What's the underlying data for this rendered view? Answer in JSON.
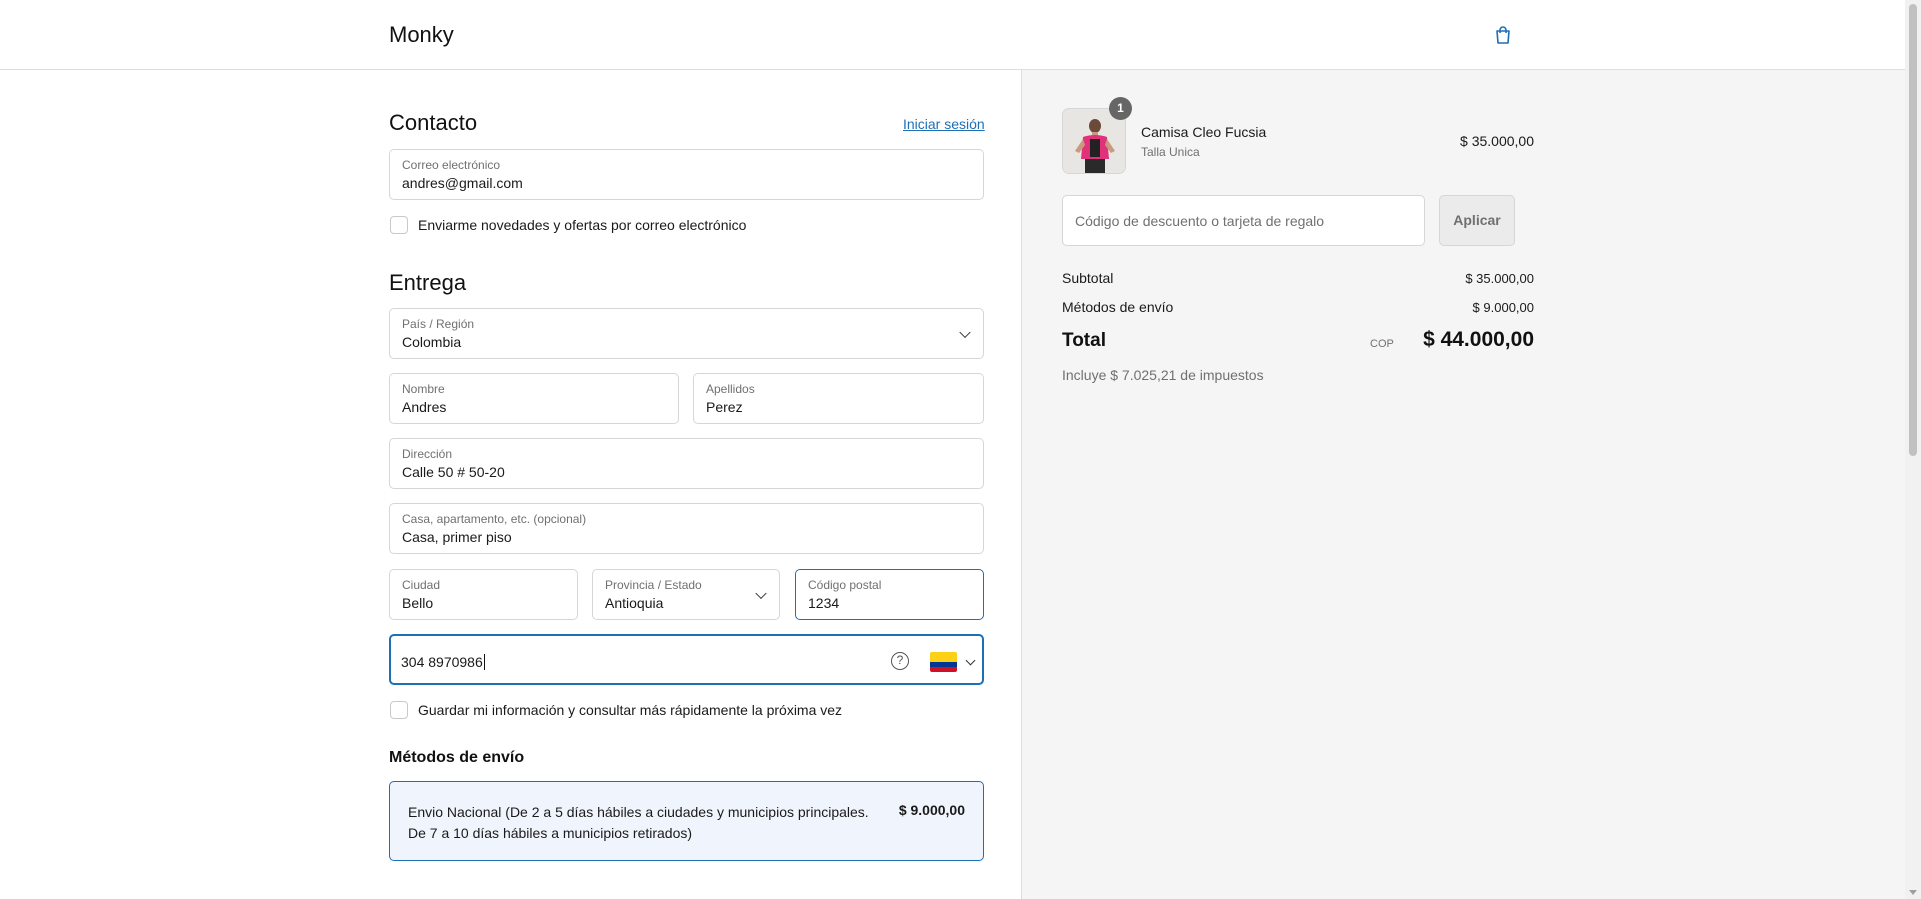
{
  "header": {
    "brand": "Monky",
    "cart_icon": "shopping-bag-icon"
  },
  "contact": {
    "title": "Contacto",
    "login_link": "Iniciar sesión",
    "email_label": "Correo electrónico",
    "email_value": "andres@gmail.com",
    "newsletter_label": "Enviarme novedades y ofertas por correo electrónico"
  },
  "delivery": {
    "title": "Entrega",
    "country_label": "País / Región",
    "country_value": "Colombia",
    "first_name_label": "Nombre",
    "first_name_value": "Andres",
    "last_name_label": "Apellidos",
    "last_name_value": "Perez",
    "address_label": "Dirección",
    "address_value": "Calle 50 # 50-20",
    "apt_label": "Casa, apartamento, etc. (opcional)",
    "apt_value": "Casa, primer piso",
    "city_label": "Ciudad",
    "city_value": "Bello",
    "state_label": "Provincia / Estado",
    "state_value": "Antioquia",
    "zip_label": "Código postal",
    "zip_value": "1234",
    "phone_value": "304 8970986",
    "help_icon": "question-circle-icon",
    "flag_icon": "colombia-flag-icon",
    "save_info_label": "Guardar mi información y consultar más rápidamente la próxima vez"
  },
  "shipping": {
    "title": "Métodos de envío",
    "option_description": "Envio Nacional (De 2 a 5 días hábiles a ciudades y municipios principales. De 7 a 10 días hábiles a municipios retirados)",
    "option_price": "$ 9.000,00"
  },
  "summary": {
    "product_name": "Camisa Cleo Fucsia",
    "product_variant": "Talla Unica",
    "product_price": "$ 35.000,00",
    "quantity": "1",
    "discount_placeholder": "Código de descuento o tarjeta de regalo",
    "apply_label": "Aplicar",
    "subtotal_label": "Subtotal",
    "subtotal_value": "$ 35.000,00",
    "shipping_label": "Métodos de envío",
    "shipping_value": "$ 9.000,00",
    "total_label": "Total",
    "currency": "COP",
    "total_value": "$ 44.000,00",
    "taxes_note": "Incluye $ 7.025,21 de impuestos"
  },
  "colors": {
    "accent": "#1f6fb5",
    "sidebar_bg": "#f5f5f5",
    "shipping_option_bg": "#f0f5fd"
  }
}
